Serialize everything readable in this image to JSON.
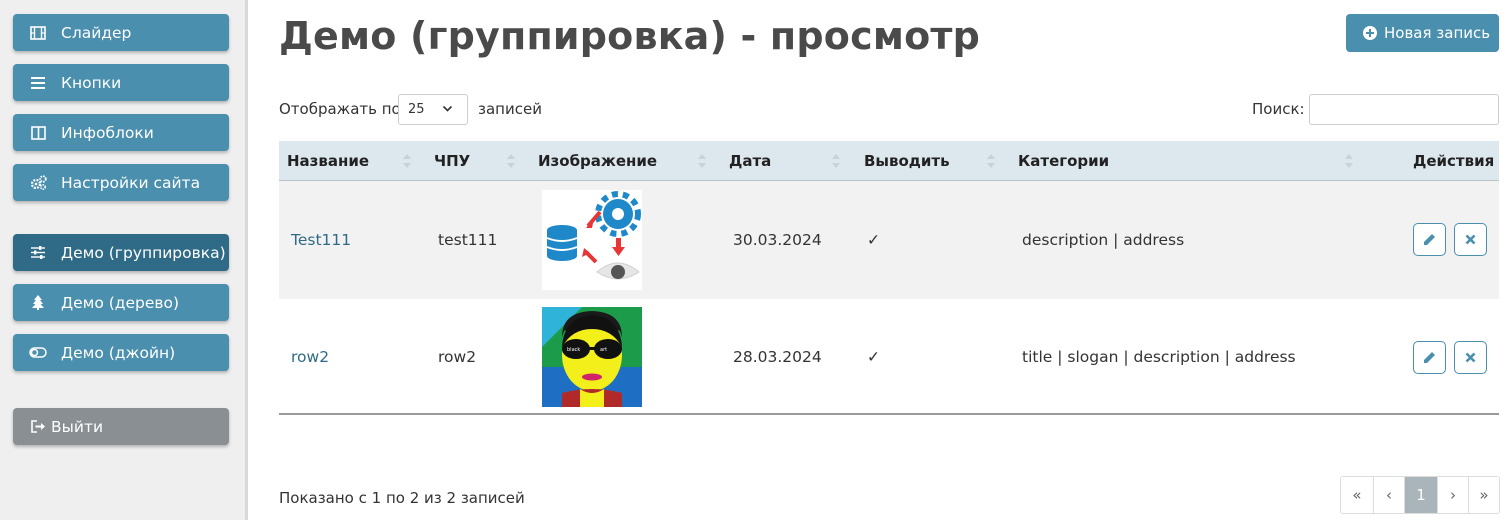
{
  "sidebar": {
    "items": [
      {
        "label": "Слайдер",
        "icon": "film-icon"
      },
      {
        "label": "Кнопки",
        "icon": "bars-icon"
      },
      {
        "label": "Инфоблоки",
        "icon": "columns-icon"
      },
      {
        "label": "Настройки сайта",
        "icon": "gears-icon"
      },
      {
        "label": "Демо (группировка)",
        "icon": "sliders-icon",
        "active": true
      },
      {
        "label": "Демо (дерево)",
        "icon": "tree-icon"
      },
      {
        "label": "Демо (джойн)",
        "icon": "toggle-icon"
      }
    ],
    "logout_label": "Выйти"
  },
  "header": {
    "title": "Демо (группировка) - просмотр",
    "new_record_label": "Новая запись"
  },
  "controls": {
    "length_prefix": "Отображать по",
    "length_value": "25",
    "length_suffix": "записей",
    "search_label": "Поиск:",
    "search_value": ""
  },
  "table": {
    "columns": [
      "Название",
      "ЧПУ",
      "Изображение",
      "Дата",
      "Выводить",
      "Категории",
      "Действия"
    ],
    "rows": [
      {
        "name": "Test111",
        "slug": "test111",
        "image": "database-settings-image",
        "date": "30.03.2024",
        "visible": "✓",
        "categories": "description | address"
      },
      {
        "name": "row2",
        "slug": "row2",
        "image": "pop-art-portrait-image",
        "date": "28.03.2024",
        "visible": "✓",
        "categories": "title | slogan | description | address"
      }
    ]
  },
  "footer": {
    "info": "Показано с 1 по 2 из 2 записей",
    "pagination": [
      "«",
      "‹",
      "1",
      "›",
      "»"
    ],
    "current_page": "1"
  },
  "colors": {
    "accent": "#4a8fae",
    "accent_active": "#2f6b86",
    "logout": "#8a8f93",
    "table_header": "#dde7ee"
  }
}
